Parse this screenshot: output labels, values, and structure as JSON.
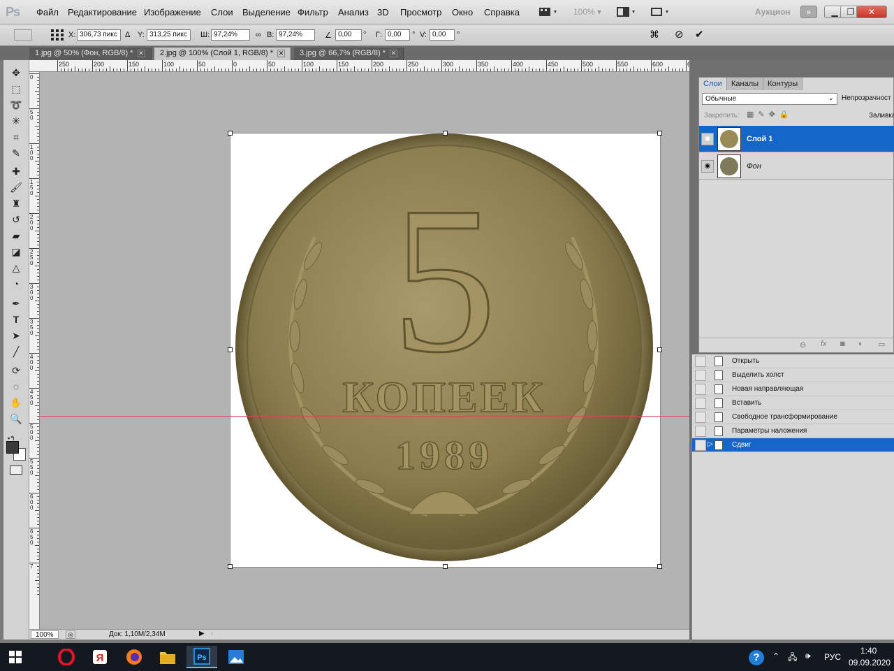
{
  "app": {
    "logo": "Ps"
  },
  "menu": {
    "items": [
      "Файл",
      "Редактирование",
      "Изображение",
      "Слои",
      "Выделение",
      "Фильтр",
      "Анализ",
      "3D",
      "Просмотр",
      "Окно",
      "Справка"
    ],
    "zoom": "100%",
    "workspace": "Аукцион"
  },
  "options": {
    "x_label": "X:",
    "x_value": "306,73 пикс",
    "y_label": "Y:",
    "y_value": "313,25 пикс",
    "w_label": "Ш:",
    "w_value": "97,24%",
    "h_label": "В:",
    "h_value": "97,24%",
    "angle_value": "0,00",
    "angle_unit": "°",
    "hskew_label": "Г:",
    "hskew_value": "0,00",
    "hskew_unit": "°",
    "vskew_label": "V:",
    "vskew_value": "0,00",
    "vskew_unit": "°"
  },
  "tabs": [
    {
      "label": "1.jpg @ 50% (Фон, RGB/8) *"
    },
    {
      "label": "2.jpg @ 100% (Слой 1, RGB/8) *"
    },
    {
      "label": "3.jpg @ 66,7% (RGB/8) *"
    }
  ],
  "ruler": {
    "top": [
      "250",
      "200",
      "150",
      "100",
      "50",
      "0",
      "50",
      "100",
      "150",
      "200",
      "250",
      "300",
      "350",
      "400",
      "450",
      "500",
      "550",
      "600",
      "650",
      "700",
      "750",
      "800",
      "850"
    ],
    "left": [
      "0",
      "5 0",
      "1 0 0",
      "1 5 0",
      "2 0 0",
      "2 5 0",
      "3 0 0",
      "3 5 0",
      "4 0 0",
      "4 5 0",
      "5 0 0",
      "5 5 0",
      "6 0 0",
      "6 5 0",
      "7"
    ]
  },
  "coin": {
    "numeral": "5",
    "word": "КОПЕЕК",
    "year": "1989"
  },
  "status": {
    "zoom": "100%",
    "doc": "Док: 1,10M/2,34M"
  },
  "layers": {
    "tabs": [
      "Слои",
      "Каналы",
      "Контуры"
    ],
    "blend_mode": "Обычные",
    "opacity_label": "Непрозрачност",
    "lock_label": "Закрепить:",
    "fill_label": "Заливка",
    "items": [
      {
        "name": "Слой 1",
        "selected": true
      },
      {
        "name": "Фон",
        "selected": false
      }
    ]
  },
  "history": {
    "items": [
      {
        "label": "Открыть"
      },
      {
        "label": "Выделить холст"
      },
      {
        "label": "Новая направляющая"
      },
      {
        "label": "Вставить"
      },
      {
        "label": "Свободное трансформирование"
      },
      {
        "label": "Параметры наложения"
      },
      {
        "label": "Сдвиг",
        "selected": true
      }
    ]
  },
  "taskbar": {
    "lang": "РУС",
    "time": "1:40",
    "date": "09.09.2020",
    "colors": {
      "accent": "#1566c9",
      "taskbar": "#14191f"
    }
  }
}
